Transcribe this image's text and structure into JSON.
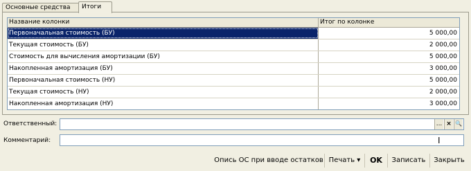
{
  "tabs": [
    {
      "label": "Основные средства",
      "active": false
    },
    {
      "label": "Итоги",
      "active": true
    }
  ],
  "table": {
    "headers": [
      "Название колонки",
      "Итог по колонке"
    ],
    "rows": [
      {
        "name": "Первоначальная стоимость (БУ)",
        "total": "5 000,00",
        "selected": true
      },
      {
        "name": "Текущая стоимость (БУ)",
        "total": "2 000,00"
      },
      {
        "name": "Стоимость для вычисления амортизации (БУ)",
        "total": "5 000,00"
      },
      {
        "name": "Накопленная амортизация (БУ)",
        "total": "3 000,00"
      },
      {
        "name": "Первоначальная стоимость (НУ)",
        "total": "5 000,00"
      },
      {
        "name": "Текущая стоимость (НУ)",
        "total": "2 000,00"
      },
      {
        "name": "Накопленная амортизация (НУ)",
        "total": "3 000,00"
      }
    ]
  },
  "form": {
    "responsible_label": "Ответственный:",
    "responsible_value": "",
    "comment_label": "Комментарий:",
    "comment_value": "",
    "select_button": "...",
    "clear_button": "×",
    "open_button": "🔍"
  },
  "buttons": {
    "doc_description": "Опись ОС при вводе остатков",
    "print": "Печать",
    "print_arrow": "▾",
    "ok": "OK",
    "save": "Записать",
    "close": "Закрыть"
  },
  "colors": {
    "selection": "#0a246a",
    "background": "#f1efe2"
  }
}
